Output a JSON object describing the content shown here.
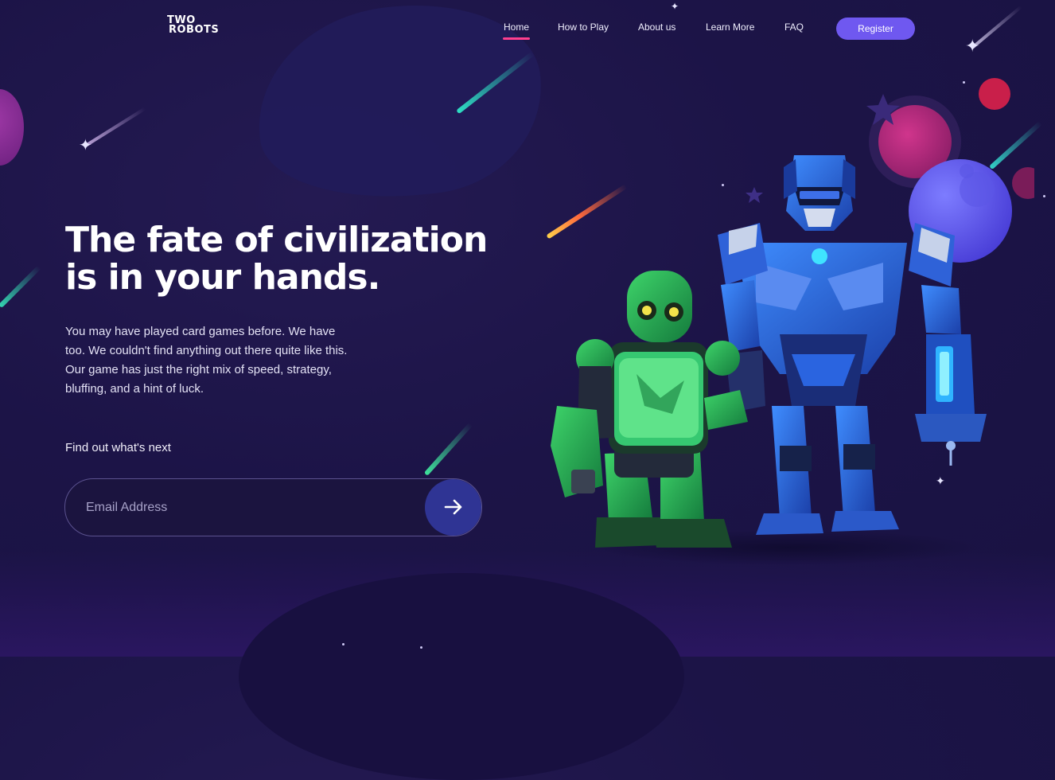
{
  "brand": {
    "logo_line1": "TWO",
    "logo_line2": "ROBOTS"
  },
  "nav": {
    "items": [
      {
        "label": "Home",
        "active": true
      },
      {
        "label": "How to Play"
      },
      {
        "label": "About us"
      },
      {
        "label": "Learn More"
      },
      {
        "label": "FAQ"
      }
    ],
    "register_label": "Register"
  },
  "hero": {
    "title_line1": "The fate of civilization",
    "title_line2": "is in your hands.",
    "lead": "You may have played card games before. We have too. We couldn't find anything out there quite like this. Our game has just the right mix of speed, strategy, bluffing, and a hint of luck.",
    "cta_label": "Find out what's next",
    "email_placeholder": "Email Address",
    "submit_icon": "arrow-right-icon"
  },
  "colors": {
    "background": "#1c1447",
    "accent": "#6f58f0",
    "nav_underline": "#ff3f8e",
    "submit_button": "#2f3494"
  }
}
